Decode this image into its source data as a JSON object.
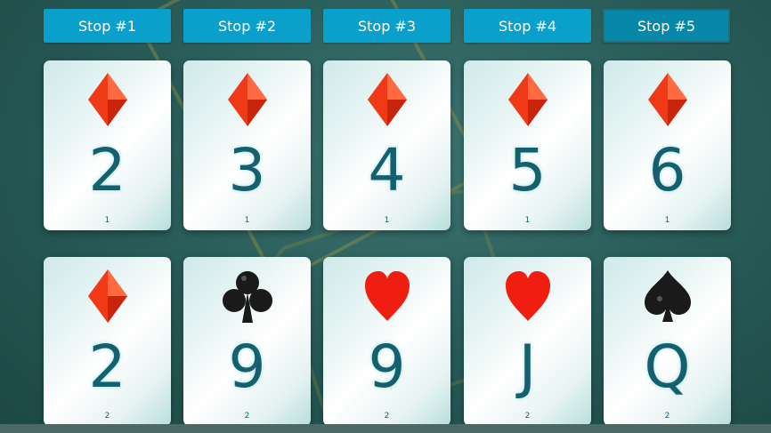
{
  "buttons": [
    {
      "label": "Stop #1",
      "active": false
    },
    {
      "label": "Stop #2",
      "active": false
    },
    {
      "label": "Stop #3",
      "active": false
    },
    {
      "label": "Stop #4",
      "active": false
    },
    {
      "label": "Stop #5",
      "active": true
    }
  ],
  "row1": [
    {
      "rank": "2",
      "suit": "diamond-icon",
      "index": "1"
    },
    {
      "rank": "3",
      "suit": "diamond-icon",
      "index": "1"
    },
    {
      "rank": "4",
      "suit": "diamond-icon",
      "index": "1"
    },
    {
      "rank": "5",
      "suit": "diamond-icon",
      "index": "1"
    },
    {
      "rank": "6",
      "suit": "diamond-icon",
      "index": "1"
    }
  ],
  "row2": [
    {
      "rank": "2",
      "suit": "diamond-icon",
      "index": "2"
    },
    {
      "rank": "9",
      "suit": "club-icon",
      "index": "2"
    },
    {
      "rank": "9",
      "suit": "heart-icon",
      "index": "2"
    },
    {
      "rank": "J",
      "suit": "heart-icon",
      "index": "2"
    },
    {
      "rank": "Q",
      "suit": "spade-icon",
      "index": "2"
    }
  ],
  "colors": {
    "button": "#0aa0cc",
    "button_active": "#0788a8",
    "rank_text": "#15606f",
    "red_suit": "#f03a17",
    "black_suit": "#1a1a1a"
  }
}
